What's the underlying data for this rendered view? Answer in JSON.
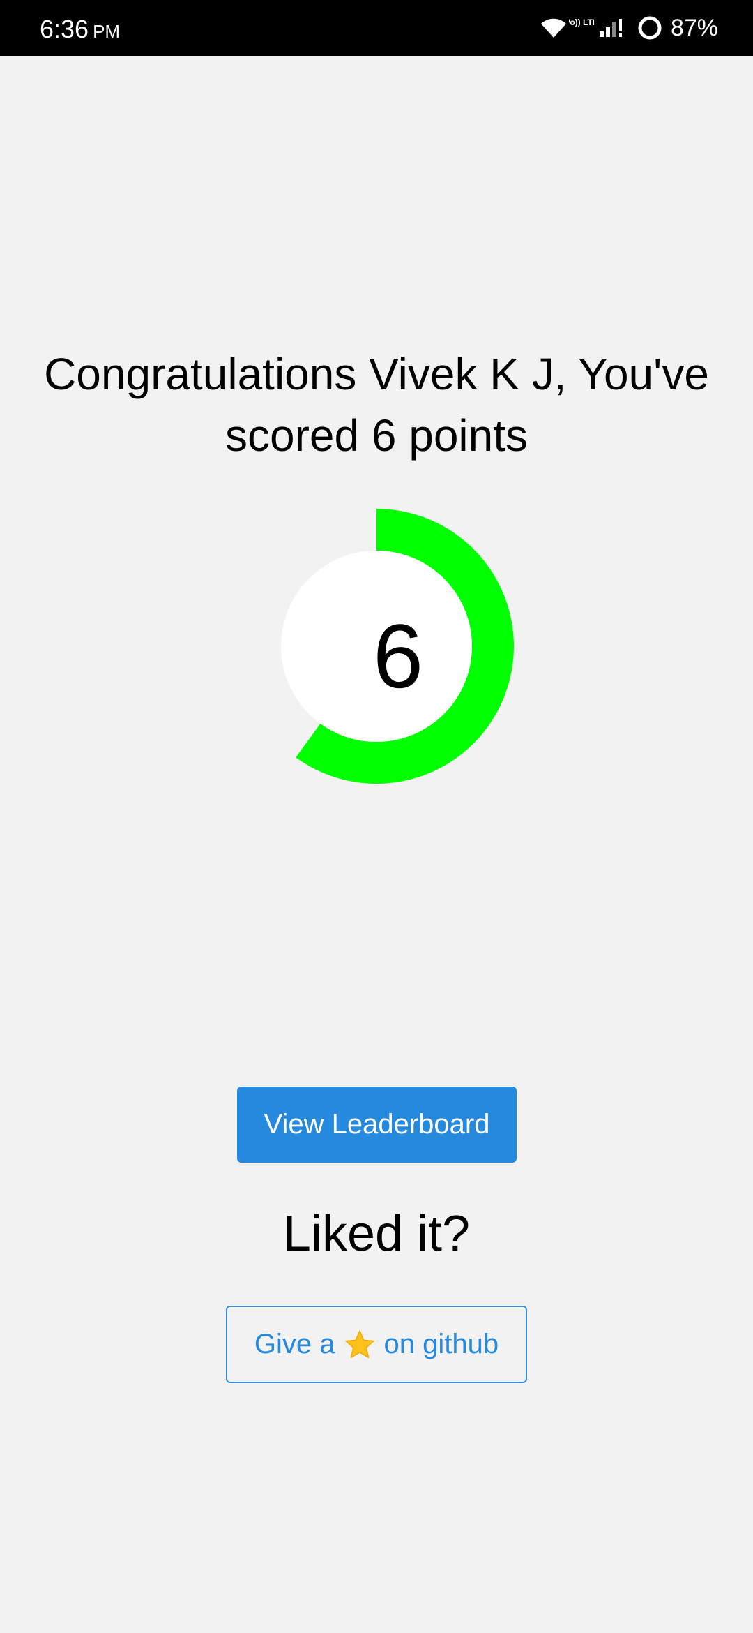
{
  "status_bar": {
    "time": "6:36",
    "ampm": "PM",
    "volte_label": "Vo)) LTE",
    "battery_percent": "87%",
    "icons": [
      "wifi-icon",
      "volte-icon",
      "signal-icon",
      "battery-icon"
    ]
  },
  "result": {
    "headline": "Congratulations Vivek K J, You've scored 6 points",
    "score": "6",
    "score_fraction": 0.6,
    "gauge_color": "#00ff00"
  },
  "actions": {
    "leaderboard_label": "View Leaderboard",
    "liked_prompt": "Liked it?",
    "github_prefix": "Give a",
    "github_icon": "star-icon",
    "github_suffix": "on github"
  },
  "colors": {
    "background": "#f2f2f2",
    "primary": "#2589de",
    "gauge": "#00ff00",
    "status_bar": "#000000"
  }
}
